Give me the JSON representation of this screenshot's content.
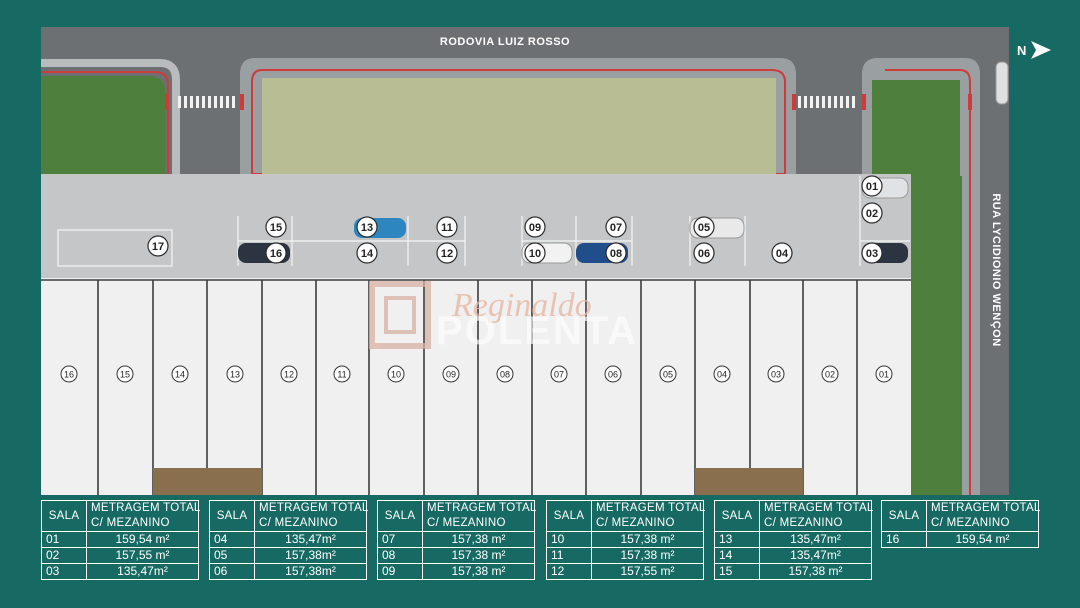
{
  "streets": {
    "top": "RODOVIA LUIZ ROSSO",
    "right": "RUA LYCIDIONIO WENÇON"
  },
  "compass": {
    "label": "N",
    "icon": "north-arrow-icon"
  },
  "watermark": {
    "script": "Reginaldo",
    "brand": "POLENTA"
  },
  "parking_spots": [
    "01",
    "02",
    "03",
    "04",
    "05",
    "06",
    "07",
    "08",
    "09",
    "10",
    "11",
    "12",
    "13",
    "14",
    "15",
    "16",
    "17"
  ],
  "units": [
    "16",
    "15",
    "14",
    "13",
    "12",
    "11",
    "10",
    "09",
    "08",
    "07",
    "06",
    "05",
    "04",
    "03",
    "02",
    "01"
  ],
  "tables": [
    {
      "header": {
        "sala": "SALA",
        "metragem_1": "METRAGEM TOTAL",
        "metragem_2": "C/ MEZANINO"
      },
      "rows": [
        {
          "sala": "01",
          "area": "159,54 m²"
        },
        {
          "sala": "02",
          "area": "157,55 m²"
        },
        {
          "sala": "03",
          "area": "135,47m²"
        }
      ]
    },
    {
      "header": {
        "sala": "SALA",
        "metragem_1": "METRAGEM TOTAL",
        "metragem_2": "C/ MEZANINO"
      },
      "rows": [
        {
          "sala": "04",
          "area": "135,47m²"
        },
        {
          "sala": "05",
          "area": "157,38m²"
        },
        {
          "sala": "06",
          "area": "157,38m²"
        }
      ]
    },
    {
      "header": {
        "sala": "SALA",
        "metragem_1": "METRAGEM TOTAL",
        "metragem_2": "C/ MEZANINO"
      },
      "rows": [
        {
          "sala": "07",
          "area": "157,38 m²"
        },
        {
          "sala": "08",
          "area": "157,38 m²"
        },
        {
          "sala": "09",
          "area": "157,38 m²"
        }
      ]
    },
    {
      "header": {
        "sala": "SALA",
        "metragem_1": "METRAGEM TOTAL",
        "metragem_2": "C/ MEZANINO"
      },
      "rows": [
        {
          "sala": "10",
          "area": "157,38 m²"
        },
        {
          "sala": "11",
          "area": "157,38 m²"
        },
        {
          "sala": "12",
          "area": "157,55 m²"
        }
      ]
    },
    {
      "header": {
        "sala": "SALA",
        "metragem_1": "METRAGEM TOTAL",
        "metragem_2": "C/ MEZANINO"
      },
      "rows": [
        {
          "sala": "13",
          "area": "135,47m²"
        },
        {
          "sala": "14",
          "area": "135,47m²"
        },
        {
          "sala": "15",
          "area": "157,38 m²"
        }
      ]
    },
    {
      "header": {
        "sala": "SALA",
        "metragem_1": "METRAGEM TOTAL",
        "metragem_2": "C/ MEZANINO"
      },
      "rows": [
        {
          "sala": "16",
          "area": "159,54 m²"
        }
      ]
    }
  ],
  "colors": {
    "background": "#166a63",
    "road": "#6b6e70",
    "curb": "#cf3a3a",
    "lawn": "#b8bd8f",
    "grass": "#4c7f3a",
    "parking": "#c8c8c8",
    "floor": "#f1f1f1"
  }
}
